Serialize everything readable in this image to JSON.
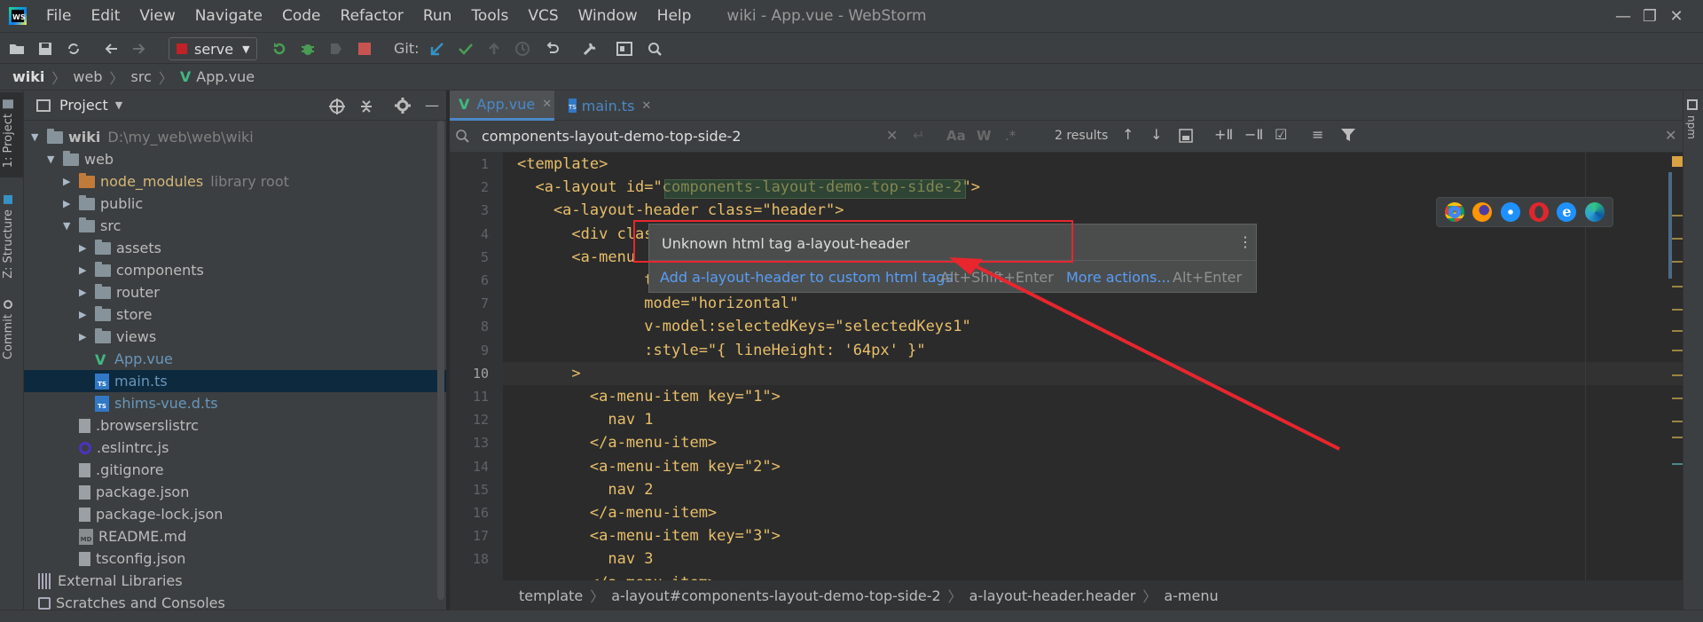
{
  "app": {
    "window_title": "wiki - App.vue - WebStorm",
    "logo_text": "WS",
    "menu": [
      "File",
      "Edit",
      "View",
      "Navigate",
      "Code",
      "Refactor",
      "Run",
      "Tools",
      "VCS",
      "Window",
      "Help"
    ]
  },
  "toolbar": {
    "run_config": "serve",
    "git_label": "Git:"
  },
  "navbar": {
    "crumbs": [
      "wiki",
      "web",
      "src",
      "App.vue"
    ]
  },
  "left_stripe": {
    "tabs": [
      "1: Project",
      "Z: Structure",
      "Commit"
    ]
  },
  "project": {
    "title": "Project",
    "tree": [
      {
        "label": "wiki",
        "extra": "D:\\my_web\\web\\wiki",
        "indent": 0,
        "kind": "folder",
        "open": true
      },
      {
        "label": "web",
        "indent": 1,
        "kind": "folder",
        "open": true
      },
      {
        "label": "node_modules",
        "extra": "library root",
        "indent": 2,
        "kind": "excluded",
        "open": false
      },
      {
        "label": "public",
        "indent": 2,
        "kind": "folder",
        "open": false
      },
      {
        "label": "src",
        "indent": 2,
        "kind": "folder",
        "open": true
      },
      {
        "label": "assets",
        "indent": 3,
        "kind": "folder",
        "open": false
      },
      {
        "label": "components",
        "indent": 3,
        "kind": "folder",
        "open": false
      },
      {
        "label": "router",
        "indent": 3,
        "kind": "folder",
        "open": false
      },
      {
        "label": "store",
        "indent": 3,
        "kind": "folder",
        "open": false
      },
      {
        "label": "views",
        "indent": 3,
        "kind": "folder",
        "open": false
      },
      {
        "label": "App.vue",
        "indent": 3,
        "kind": "vue"
      },
      {
        "label": "main.ts",
        "indent": 3,
        "kind": "ts",
        "selected": true
      },
      {
        "label": "shims-vue.d.ts",
        "indent": 3,
        "kind": "ts"
      },
      {
        "label": ".browserslistrc",
        "indent": 2,
        "kind": "file"
      },
      {
        "label": ".eslintrc.js",
        "indent": 2,
        "kind": "eslint"
      },
      {
        "label": ".gitignore",
        "indent": 2,
        "kind": "file"
      },
      {
        "label": "package.json",
        "indent": 2,
        "kind": "file"
      },
      {
        "label": "package-lock.json",
        "indent": 2,
        "kind": "file"
      },
      {
        "label": "README.md",
        "indent": 2,
        "kind": "md"
      },
      {
        "label": "tsconfig.json",
        "indent": 2,
        "kind": "file"
      },
      {
        "label": "External Libraries",
        "indent": 0,
        "kind": "lib"
      },
      {
        "label": "Scratches and Consoles",
        "indent": 0,
        "kind": "scratch"
      }
    ]
  },
  "tabs": [
    {
      "label": "App.vue",
      "active": true
    },
    {
      "label": "main.ts",
      "active": false
    }
  ],
  "search": {
    "query": "components-layout-demo-top-side-2",
    "results": "2 results",
    "case_btn": "Aa",
    "word_btn": "W"
  },
  "editor": {
    "line_numbers": [
      "1",
      "2",
      "3",
      "4",
      "5",
      "6",
      "7",
      "8",
      "9",
      "10",
      "11",
      "12",
      "13",
      "14",
      "15",
      "16",
      "17",
      "18"
    ],
    "lines": [
      "<template>",
      "  <a-layout id=\"components-layout-demo-top-side-2\">",
      "    <a-layout-header class=\"header\">",
      "      <div clas",
      "      <a-menu",
      "              t",
      "              mode=\"horizontal\"",
      "              v-model:selectedKeys=\"selectedKeys1\"",
      "              :style=\"{ lineHeight: '64px' }\"",
      "      >",
      "        <a-menu-item key=\"1\">",
      "          nav 1",
      "        </a-menu-item>",
      "        <a-menu-item key=\"2\">",
      "          nav 2",
      "        </a-menu-item>",
      "        <a-menu-item key=\"3\">",
      "          nav 3",
      "        </a-menu-item>"
    ]
  },
  "popup": {
    "message": "Unknown html tag a-layout-header",
    "action_primary": "Add a-layout-header to custom html tags",
    "action_primary_shortcut": "Alt+Shift+Enter",
    "action_more": "More actions...",
    "action_more_shortcut": "Alt+Enter"
  },
  "editor_breadcrumbs": [
    "template",
    "a-layout#components-layout-demo-top-side-2",
    "a-layout-header.header",
    "a-menu"
  ],
  "right_stripe": {
    "tab": "npm"
  },
  "colors": {
    "accent": "#4a88c7",
    "annotation_red": "#e8262d",
    "selection": "#0d293e"
  }
}
